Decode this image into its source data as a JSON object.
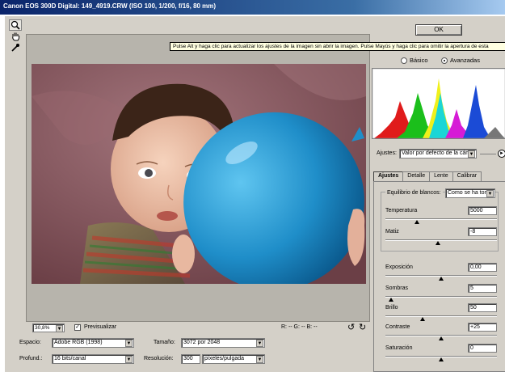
{
  "window": {
    "title": "Canon EOS 300D Digital: 149_4919.CRW  (ISO 100, 1/200, f/16, 80 mm)"
  },
  "ok_label": "OK",
  "tooltip": "Pulse Alt y haga clic para actualizar los ajustes de la imagen sin abrir la imagen. Pulse Mayús y haga clic para omitir la apertura de esta",
  "mode": {
    "basic_label": "Básico",
    "advanced_label": "Avanzadas",
    "selected": "Avanzadas"
  },
  "settings": {
    "label": "Ajustes:",
    "value": "Valor por defecto de la cám"
  },
  "tabs": [
    {
      "label": "Ajustes",
      "active": true
    },
    {
      "label": "Detalle",
      "active": false
    },
    {
      "label": "Lente",
      "active": false
    },
    {
      "label": "Calibrar",
      "active": false
    }
  ],
  "white_balance": {
    "label": "Equilibrio de blancos:",
    "value": "Como se ha tom"
  },
  "sliders": [
    {
      "label": "Temperatura",
      "value": "5000",
      "level": 0.28
    },
    {
      "label": "Matiz",
      "value": "-8",
      "level": 0.47
    },
    {
      "label": "Exposición",
      "value": "0,00",
      "level": 0.5
    },
    {
      "label": "Sombras",
      "value": "5",
      "level": 0.05
    },
    {
      "label": "Brillo",
      "value": "50",
      "level": 0.33
    },
    {
      "label": "Contraste",
      "value": "+25",
      "level": 0.5
    },
    {
      "label": "Saturación",
      "value": "0",
      "level": 0.5
    }
  ],
  "zoom": {
    "value": "30,8%",
    "preview_label": "Previsualizar",
    "preview_checked": true
  },
  "rgb_readout": "R:  --  G:  --  B:  --",
  "space": {
    "label": "Espacio:",
    "value": "Adobe RGB (1998)"
  },
  "depth": {
    "label": "Profund.:",
    "value": "16 bits/canal"
  },
  "size": {
    "label": "Tamaño:",
    "value": "3072 por 2048"
  },
  "resolution": {
    "label": "Resolución:",
    "value": "300",
    "unit": "píxeles/pulgada"
  },
  "colors": {
    "title_bar": "#0a246a",
    "dialog": "#d4d0c8",
    "balloon": "#1f8ec9",
    "backdrop": "#7a4a50"
  },
  "icons": [
    "zoom-icon",
    "hand-icon",
    "eyedropper-icon",
    "arrow-right-circle-icon",
    "rotate-left-icon",
    "rotate-right-icon"
  ]
}
